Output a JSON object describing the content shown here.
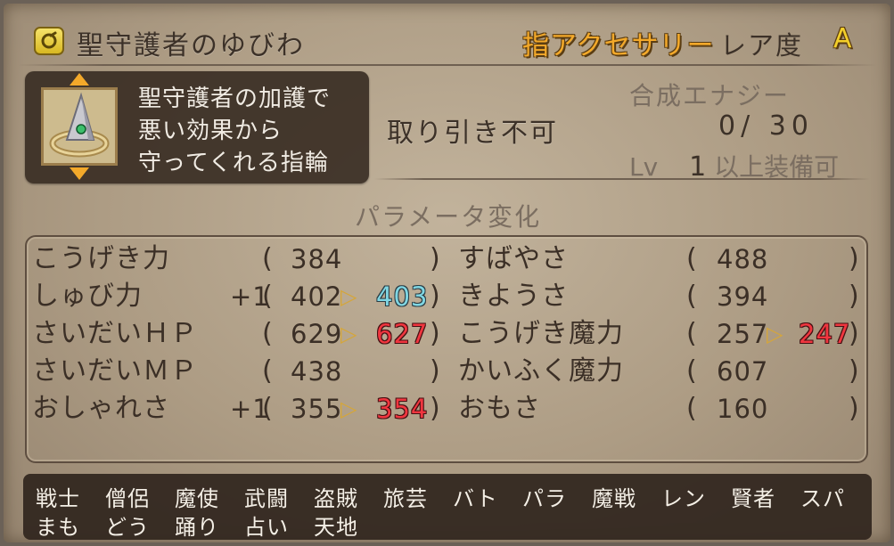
{
  "item": {
    "name": "聖守護者のゆびわ",
    "category": "指アクセサリー",
    "rarity_label": "レア度",
    "rarity": "A",
    "description": [
      "聖守護者の加護で",
      "悪い効果から",
      "守ってくれる指輪"
    ],
    "trade_status": "取り引き不可",
    "energy_label": "合成エナジー",
    "energy_value": "0/ 30",
    "lv_label": "Lv",
    "lv_value": "1",
    "lv_suffix": "以上装備可"
  },
  "params_title": "パラメータ変化",
  "stats_left": [
    {
      "name": "こうげき力",
      "bonus": "",
      "current": "384",
      "new": "",
      "change": ""
    },
    {
      "name": "しゅび力",
      "bonus": "+1",
      "current": "402",
      "new": "403",
      "change": "up"
    },
    {
      "name": "さいだいＨＰ",
      "bonus": "",
      "current": "629",
      "new": "627",
      "change": "down"
    },
    {
      "name": "さいだいＭＰ",
      "bonus": "",
      "current": "438",
      "new": "",
      "change": ""
    },
    {
      "name": "おしゃれさ",
      "bonus": "+1",
      "current": "355",
      "new": "354",
      "change": "down"
    }
  ],
  "stats_right": [
    {
      "name": "すばやさ",
      "current": "488",
      "new": "",
      "change": ""
    },
    {
      "name": "きようさ",
      "current": "394",
      "new": "",
      "change": ""
    },
    {
      "name": "こうげき魔力",
      "current": "257",
      "new": "247",
      "change": "down"
    },
    {
      "name": "かいふく魔力",
      "current": "607",
      "new": "",
      "change": ""
    },
    {
      "name": "おもさ",
      "current": "160",
      "new": "",
      "change": ""
    }
  ],
  "jobs_row1": [
    "戦士",
    "僧侶",
    "魔使",
    "武闘",
    "盗賊",
    "旅芸",
    "バト",
    "パラ",
    "魔戦",
    "レン",
    "賢者",
    "スパ"
  ],
  "jobs_row2": [
    "まも",
    "どう",
    "踊り",
    "占い",
    "天地"
  ],
  "colors": {
    "increase": "#7fd6e3",
    "decrease": "#f0363f",
    "accent": "#f3a92a"
  },
  "icons": {
    "category_icon": "ring-category-icon",
    "item_image": "ring-icon"
  }
}
